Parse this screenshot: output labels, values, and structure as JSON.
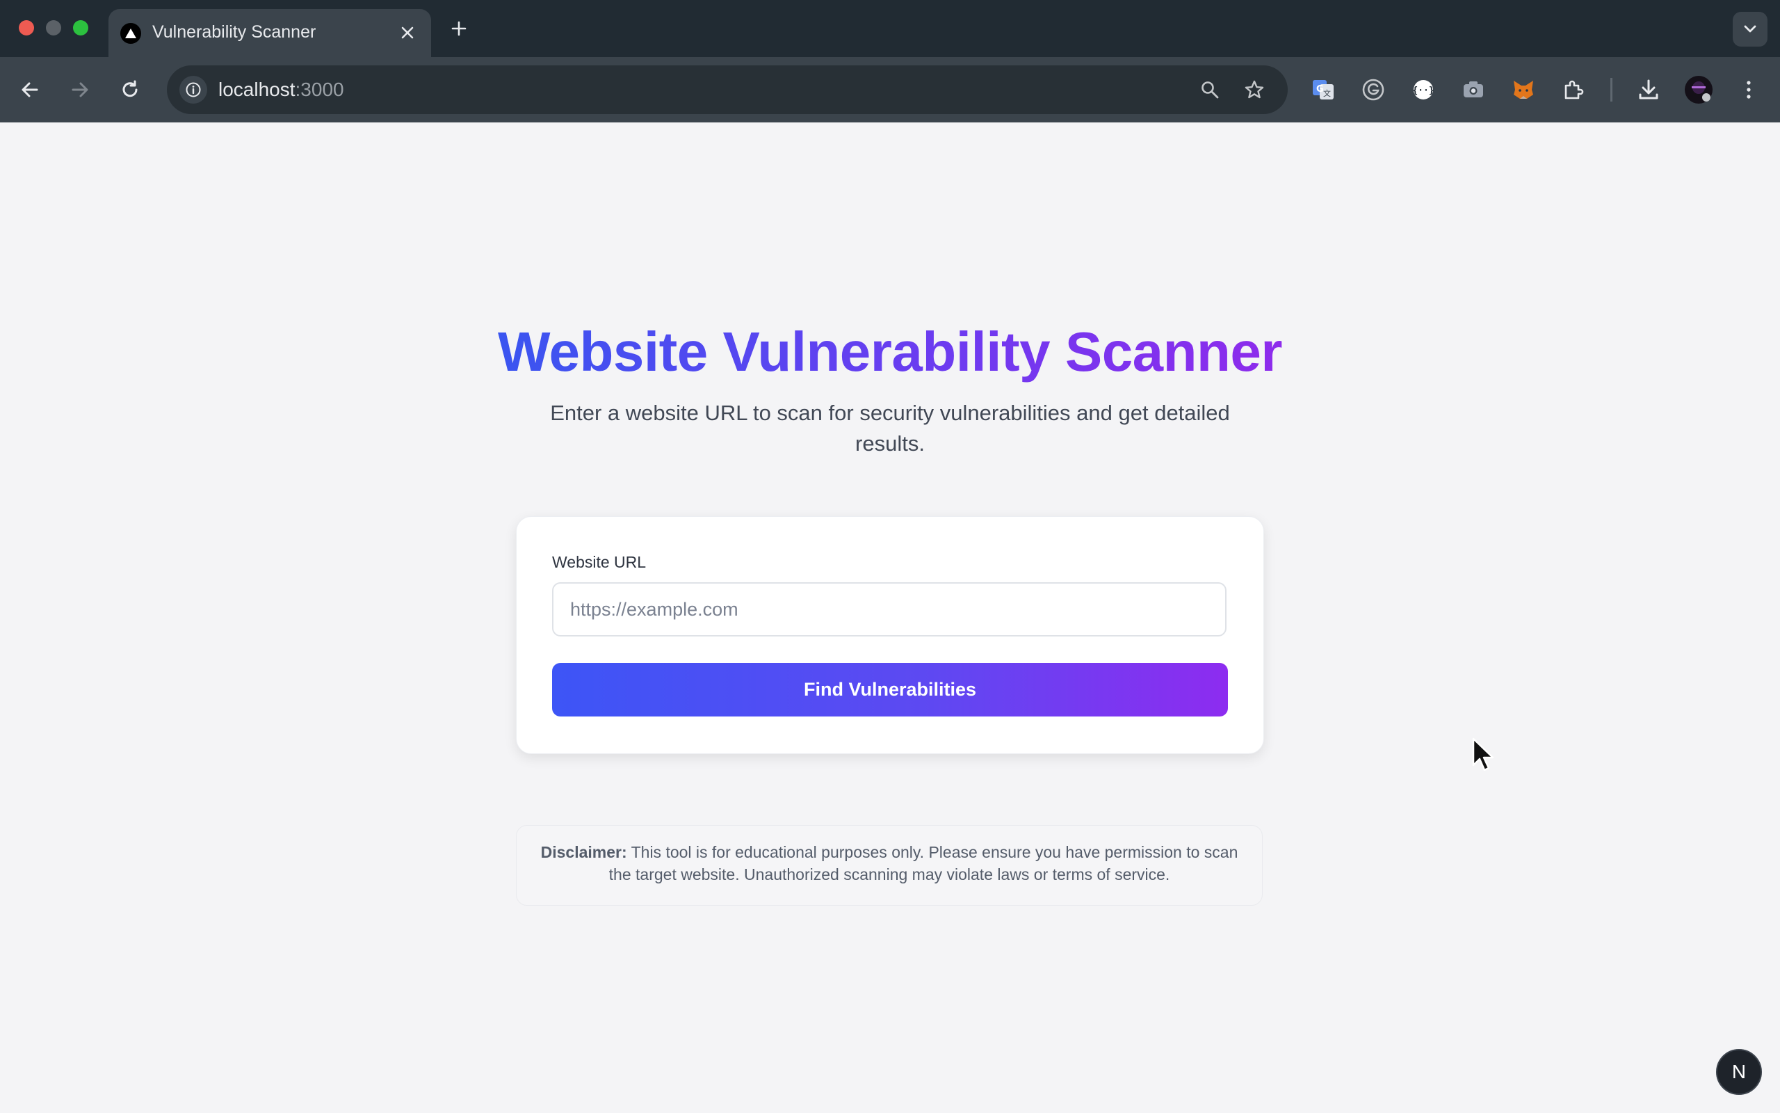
{
  "browser": {
    "tab": {
      "title": "Vulnerability Scanner"
    },
    "address_bar": {
      "host": "localhost",
      "port": ":3000"
    },
    "extensions": [
      "google-translate-icon",
      "grammarly-icon",
      "code-extension-icon",
      "screenshot-icon",
      "metamask-icon",
      "puzzle-icon"
    ]
  },
  "page": {
    "title": "Website Vulnerability Scanner",
    "subtitle": "Enter a website URL to scan for security vulnerabilities and get detailed results.",
    "form": {
      "url_label": "Website URL",
      "url_placeholder": "https://example.com",
      "url_value": "",
      "submit_label": "Find Vulnerabilities"
    },
    "disclaimer": {
      "label": "Disclaimer:",
      "text": " This tool is for educational purposes only. Please ensure you have permission to scan the target website. Unauthorized scanning may violate laws or terms of service."
    },
    "dev_badge": "N"
  },
  "colors": {
    "gradient_start": "#3d55f6",
    "gradient_end": "#8d2cf0",
    "tabbar": "#212b33",
    "toolbar": "#3b444c",
    "page_bg": "#f4f4f6"
  }
}
